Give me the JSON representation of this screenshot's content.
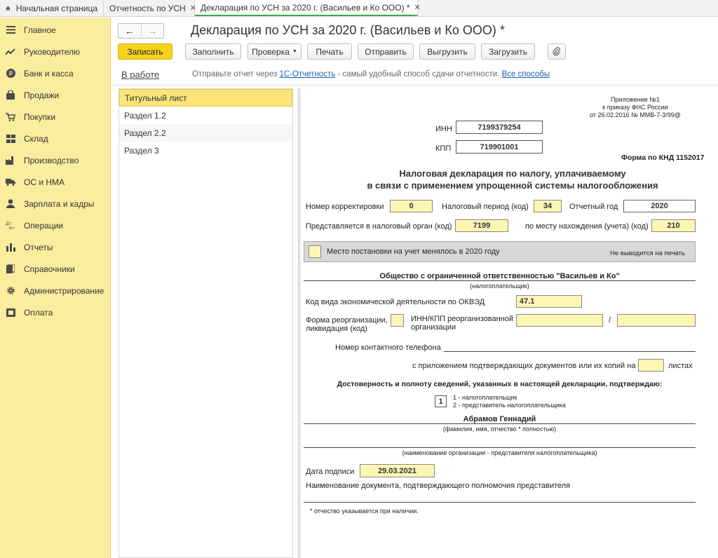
{
  "tabs": {
    "home": "Начальная страница",
    "t1": "Отчетность по УСН",
    "t2": "Декларация по УСН за 2020 г. (Васильев и Ко ООО) *"
  },
  "sidebar": {
    "items": [
      {
        "label": "Главное",
        "icon": "menu-icon"
      },
      {
        "label": "Руководителю",
        "icon": "chart-trend-icon"
      },
      {
        "label": "Банк и касса",
        "icon": "ruble-icon"
      },
      {
        "label": "Продажи",
        "icon": "bag-icon"
      },
      {
        "label": "Покупки",
        "icon": "cart-icon"
      },
      {
        "label": "Склад",
        "icon": "warehouse-icon"
      },
      {
        "label": "Производство",
        "icon": "factory-icon"
      },
      {
        "label": "ОС и НМА",
        "icon": "truck-icon"
      },
      {
        "label": "Зарплата и кадры",
        "icon": "person-icon"
      },
      {
        "label": "Операции",
        "icon": "dt-kt-icon"
      },
      {
        "label": "Отчеты",
        "icon": "bar-chart-icon"
      },
      {
        "label": "Справочники",
        "icon": "books-icon"
      },
      {
        "label": "Администрирование",
        "icon": "gear-icon"
      },
      {
        "label": "Оплата",
        "icon": "payment-icon"
      }
    ]
  },
  "header": {
    "title": "Декларация по УСН за 2020 г. (Васильев и Ко ООО) *"
  },
  "toolbar": {
    "save": "Записать",
    "fill": "Заполнить",
    "check": "Проверка",
    "print": "Печать",
    "send": "Отправить",
    "export": "Выгрузить",
    "import": "Загрузить"
  },
  "status": {
    "state": "В работе",
    "msg_prefix": "Отправьте отчет через ",
    "msg_link1": "1С-Отчетность",
    "msg_middle": " - самый удобный способ сдачи отчетности. ",
    "msg_link2": "Все способы"
  },
  "sections": [
    "Титульный лист",
    "Раздел 1.2",
    "Раздел 2.2",
    "Раздел 3"
  ],
  "form": {
    "appendix1": "Приложение №1",
    "appendix2": "к приказу ФНС России",
    "appendix3": "от 26.02.2016 № ММВ-7-3/99@",
    "inn_label": "ИНН",
    "inn": "7199379254",
    "kpp_label": "КПП",
    "kpp": "719901001",
    "knd": "Форма по КНД 1152017",
    "heading1": "Налоговая декларация по налогу, уплачиваемому",
    "heading2": "в связи с применением упрощенной системы налогообложения",
    "corr_label": "Номер корректировки",
    "corr": "0",
    "period_label": "Налоговый период (код)",
    "period": "34",
    "year_label": "Отчетный год",
    "year": "2020",
    "organ_label": "Представляется в налоговый орган (код)",
    "organ": "7199",
    "place_label": "по месту нахождения (учета) (код)",
    "place": "210",
    "changed_label": "Место постановки на учет менялось в 2020 году",
    "not_printed": "Не выводится на печать",
    "org_name": "Общество с ограниченной ответственностью \"Васильев и Ко\"",
    "taxpayer": "(налогоплательщик)",
    "okved_label": "Код вида экономической деятельности по ОКВЭД",
    "okved": "47.1",
    "reorg_label1": "Форма реорганизации,",
    "reorg_label2": "ликвидация (код)",
    "reorg_inn1": "ИНН/КПП реорганизованной",
    "reorg_inn2": "организации",
    "slash": "/",
    "phone_label": "Номер контактного телефона",
    "pages_label": "с приложением подтверждающих документов или их копий на",
    "pages_unit": "листах",
    "confirm": "Достоверность и полноту сведений, указанных в настоящей декларации, подтверждаю:",
    "signer_code": "1",
    "signer1": "1 - налогоплательщик",
    "signer2": "2 - представитель налогоплательщика",
    "person": "Абрамов Геннадий",
    "fio": "(фамилия, имя, отчество * полностью)",
    "repr_org": "(наименование организации - представителя налогоплательщика)",
    "date_label": "Дата подписи",
    "date": "29.03.2021",
    "doc_label": "Наименование документа, подтверждающего полномочия представителя",
    "footnote": "*  отчество указывается при наличии."
  }
}
